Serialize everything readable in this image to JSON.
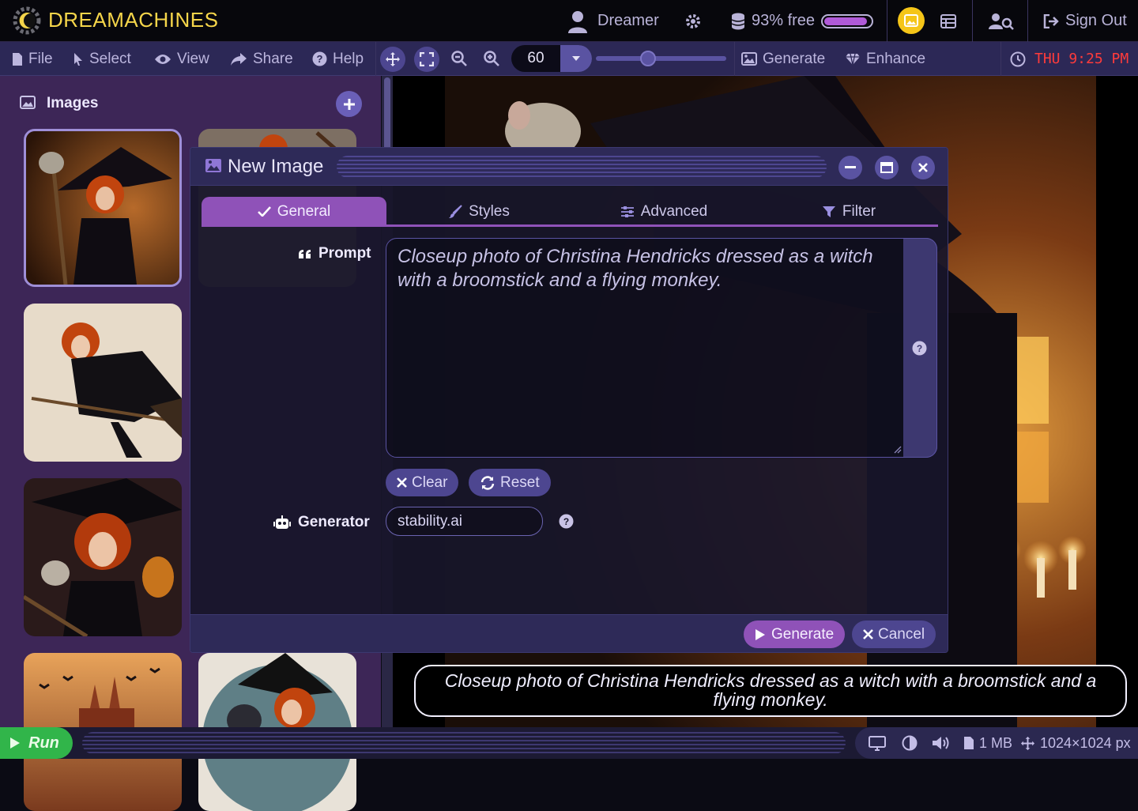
{
  "app": {
    "name": "DREAMACHINES",
    "user": "Dreamer",
    "storage": "93% free",
    "storage_fraction": 0.93,
    "sign_out": "Sign Out"
  },
  "menu": {
    "file": "File",
    "select": "Select",
    "view": "View",
    "share": "Share",
    "help": "Help",
    "zoom_value": "60",
    "zoom_slider_fraction": 0.4,
    "generate": "Generate",
    "enhance": "Enhance",
    "clock": "THU 9:25 PM"
  },
  "sidebar": {
    "title": "Images",
    "items": [
      {
        "name": "witch with monkey on broom",
        "selected": true
      },
      {
        "name": "witch with flying monkey",
        "selected": false
      },
      {
        "name": "witch flying on broomstick",
        "selected": false
      },
      {
        "name": "witch with monkey and owl",
        "selected": false
      },
      {
        "name": "castle at sunset with bats",
        "selected": false
      },
      {
        "name": "witch with cat",
        "selected": false
      }
    ]
  },
  "dialog": {
    "title": "New Image",
    "tabs": [
      {
        "label": "General",
        "icon": "check-icon",
        "active": true
      },
      {
        "label": "Styles",
        "icon": "brush-icon",
        "active": false
      },
      {
        "label": "Advanced",
        "icon": "sliders-icon",
        "active": false
      },
      {
        "label": "Filter",
        "icon": "filter-icon",
        "active": false
      }
    ],
    "prompt_label": "Prompt",
    "prompt_value": "Closeup photo of Christina Hendricks dressed as a witch with a broomstick and a flying monkey.",
    "clear_label": "Clear",
    "reset_label": "Reset",
    "generator_label": "Generator",
    "generator_value": "stability.ai",
    "generate_label": "Generate",
    "cancel_label": "Cancel"
  },
  "caption": "Closeup photo of Christina Hendricks dressed as a witch with a broomstick and a flying monkey.",
  "status": {
    "run": "Run",
    "size": "1 MB",
    "dimensions": "1024×1024 px"
  },
  "colors": {
    "accent": "#8f52b8",
    "logo": "#f5d54a",
    "clock": "#ff3b3b",
    "run": "#31b54a"
  }
}
